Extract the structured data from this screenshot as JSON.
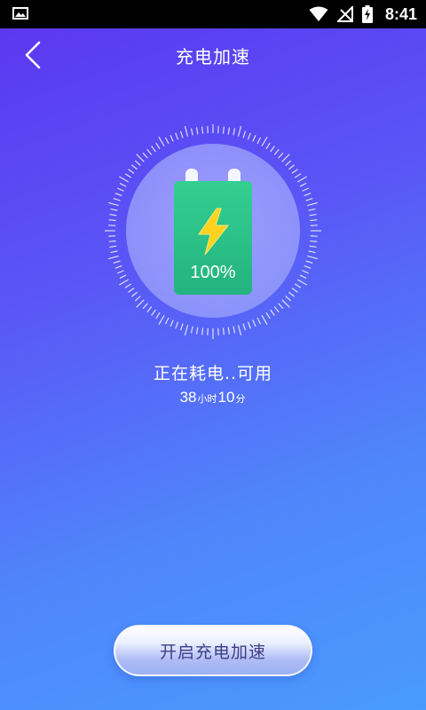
{
  "status_bar": {
    "time": "8:41",
    "icons": [
      "image-icon",
      "wifi-icon",
      "no-signal-icon",
      "battery-charging-icon"
    ]
  },
  "header": {
    "back_icon": "chevron-left-icon",
    "title": "充电加速"
  },
  "battery": {
    "percent": "100%",
    "icon": "lightning-bolt-icon",
    "level": 1.0
  },
  "status": {
    "text": "正在耗电..可用",
    "hours": "38",
    "hours_unit": "小时",
    "minutes": "10",
    "minutes_unit": "分"
  },
  "cta": {
    "label": "开启充电加速"
  },
  "colors": {
    "gradient_start": "#5b35f0",
    "gradient_end": "#4a9bfd",
    "battery_green": "#2ec28a",
    "bolt_yellow": "#ffd21e",
    "button_text": "#3f3d86"
  }
}
